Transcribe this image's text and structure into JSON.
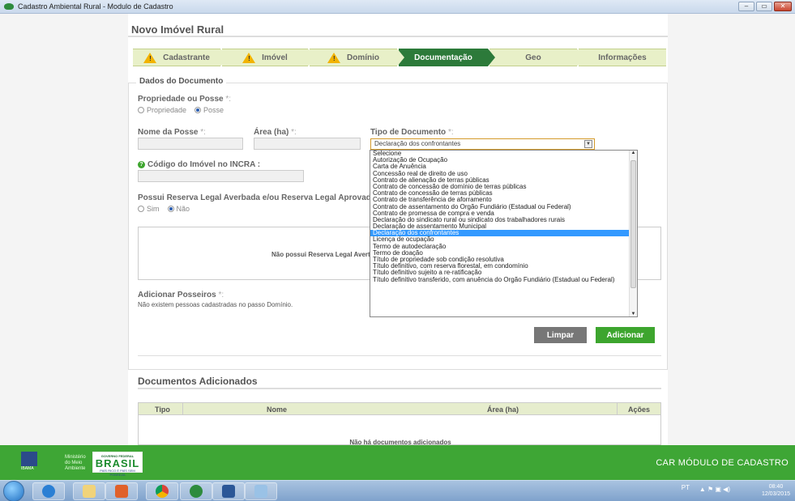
{
  "window": {
    "title": "Cadastro Ambiental Rural - Modulo de Cadastro",
    "buttons": [
      "–",
      "▭",
      "✕"
    ]
  },
  "page": {
    "title": "Novo Imóvel Rural"
  },
  "steps": [
    {
      "label": "Cadastrante",
      "warning": true,
      "active": false
    },
    {
      "label": "Imóvel",
      "warning": true,
      "active": false
    },
    {
      "label": "Domínio",
      "warning": true,
      "active": false
    },
    {
      "label": "Documentação",
      "warning": false,
      "active": true
    },
    {
      "label": "Geo",
      "warning": false,
      "active": false
    },
    {
      "label": "Informações",
      "warning": false,
      "active": false
    }
  ],
  "form": {
    "section_title": "Dados do Documento",
    "propriedade_label": "Propriedade ou Posse",
    "required_mark": "*:",
    "opt_propriedade": "Propriedade",
    "opt_posse": "Posse",
    "nome_posse_label": "Nome da Posse",
    "area_label": "Área (ha)",
    "tipo_doc_label": "Tipo de Documento",
    "tipo_doc_value": "Declaração dos confrontantes",
    "incra_label": "Código do Imóvel no INCRA :",
    "reserva_label": "Possui Reserva Legal Averbada e/ou Reserva Legal Aprovada e nã",
    "opt_sim": "Sim",
    "opt_nao": "Não",
    "reserva_msg": "Não possui Reserva Legal Avert",
    "posseiros_label": "Adicionar Posseiros",
    "posseiros_msg": "Não existem pessoas cadastradas no passo Domínio.",
    "btn_limpar": "Limpar",
    "btn_adicionar": "Adicionar"
  },
  "dropdown_options": [
    "Selecione",
    "Autorização de Ocupação",
    "Carta de Anuência",
    "Concessão real de direito de uso",
    "Contrato de alienação de terras públicas",
    "Contrato de concessão de domínio de terras públicas",
    "Contrato de concessão de terras públicas",
    "Contrato de transferência de aforramento",
    "Contrato de assentamento do Órgão Fundiário (Estadual ou Federal)",
    "Contrato de promessa de compra e venda",
    "Declaração do sindicato rural ou sindicato dos trabalhadores rurais",
    "Declaração de assentamento Municipal",
    "Declaração dos confrontantes",
    "Licença de ocupação",
    "Termo de autodeclaração",
    "Termo de doação",
    "Título de propriedade sob condição resolutiva",
    "Título definitivo, com reserva florestal, em condomínio",
    "Título definitivo sujeito a re-ratificação",
    "Título definitivo transferido, com anuência do Órgão Fundiário (Estadual ou Federal)"
  ],
  "dropdown_selected_index": 12,
  "docs": {
    "section_title": "Documentos Adicionados",
    "col_tipo": "Tipo",
    "col_nome": "Nome",
    "col_area": "Área (ha)",
    "col_acoes": "Ações",
    "empty": "Não há documentos adicionados"
  },
  "footer": {
    "ministerio": "Ministério do Meio Ambiente",
    "ibama": "IBAMA",
    "brasil_top": "GOVERNO FEDERAL",
    "brasil": "BRASIL",
    "brasil_sub": "PAÍS RICO É PAÍS SEM POBREZA",
    "car": "CAR MÓDULO DE CADASTRO"
  },
  "taskbar": {
    "lang": "PT",
    "time": "08:40",
    "date": "12/03/2015",
    "apps": [
      "internet-explorer-icon",
      "file-explorer-icon",
      "office-icon",
      "chrome-icon",
      "car-app-icon",
      "word-icon",
      "paint-icon"
    ]
  },
  "colors": {
    "accent": "#2c7a3a",
    "footer": "#3ea635",
    "step_bg": "#e8f0c8",
    "warning": "#f2b300",
    "selection": "#3399ff"
  }
}
